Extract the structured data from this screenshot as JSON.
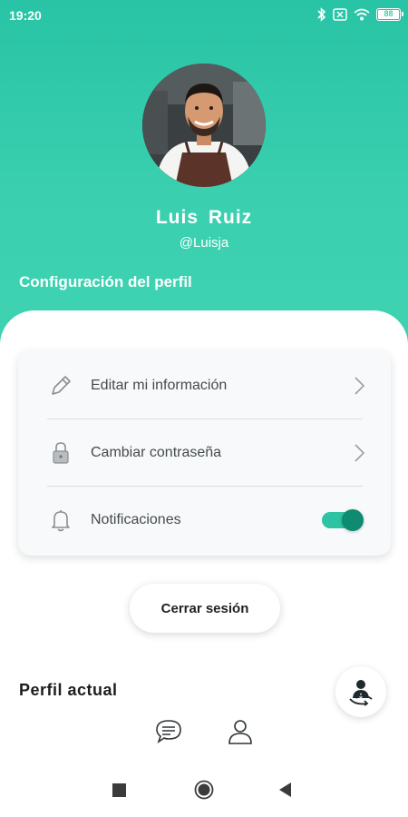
{
  "status_bar": {
    "time": "19:20",
    "icons": [
      "bluetooth-icon",
      "sim-off-icon",
      "wifi-icon",
      "battery-icon"
    ],
    "battery_level": "88"
  },
  "profile": {
    "name": "Luis  Ruiz",
    "handle": "@Luisja",
    "avatar": "avatar-photo"
  },
  "settings": {
    "title": "Configuración del perfil",
    "items": [
      {
        "label": "Editar mi información",
        "icon": "pencil-icon",
        "control": "chevron-right-icon"
      },
      {
        "label": "Cambiar contraseña",
        "icon": "lock-icon",
        "control": "chevron-right-icon"
      },
      {
        "label": "Notificaciones",
        "icon": "bell-icon",
        "control": "toggle",
        "enabled": true
      }
    ]
  },
  "logout_label": "Cerrar sesión",
  "current_profile": {
    "label": "Perfil actual",
    "switch_icon": "switch-profile-icon"
  },
  "tab_bar": {
    "items": [
      "chat-icon",
      "user-icon"
    ]
  },
  "nav_bar": {
    "items": [
      "recent-apps-icon",
      "home-icon",
      "back-icon"
    ]
  },
  "colors": {
    "header": "#3ccfae",
    "accent": "#0f8b72",
    "toggle_track": "#2ec4a3"
  }
}
